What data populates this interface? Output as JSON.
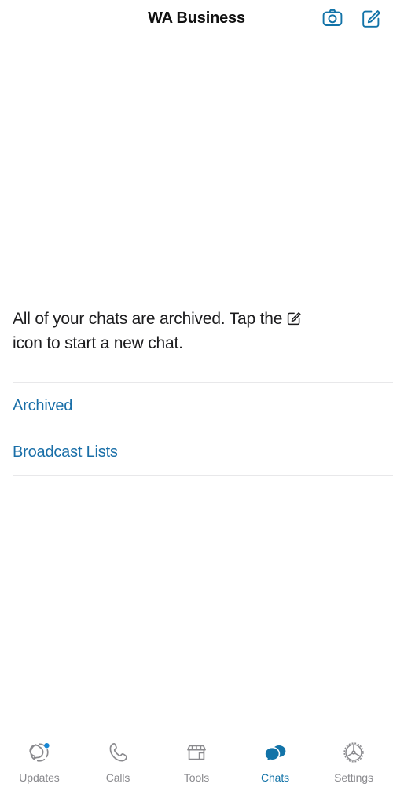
{
  "header": {
    "title": "WA Business",
    "camera_icon": "camera-icon",
    "compose_icon": "compose-icon"
  },
  "main": {
    "empty_message_part1": "All of your chats are archived. Tap the",
    "empty_message_part2": "icon to start a new chat.",
    "inline_icon": "compose-icon",
    "rows": [
      {
        "label": "Archived",
        "name": "archived"
      },
      {
        "label": "Broadcast Lists",
        "name": "broadcast-lists"
      }
    ]
  },
  "tabbar": {
    "tabs": [
      {
        "label": "Updates",
        "icon": "updates-icon",
        "active": false,
        "badge": true
      },
      {
        "label": "Calls",
        "icon": "calls-icon",
        "active": false,
        "badge": false
      },
      {
        "label": "Tools",
        "icon": "tools-icon",
        "active": false,
        "badge": false
      },
      {
        "label": "Chats",
        "icon": "chats-icon",
        "active": true,
        "badge": false
      },
      {
        "label": "Settings",
        "icon": "settings-icon",
        "active": false,
        "badge": false
      }
    ]
  },
  "colors": {
    "accent_blue": "#1273a8",
    "link_blue": "#1a6fa8",
    "inactive_gray": "#8a8a8e",
    "divider": "#e8e8ea",
    "text_primary": "#1c1c1e",
    "badge_blue": "#1787d4"
  }
}
